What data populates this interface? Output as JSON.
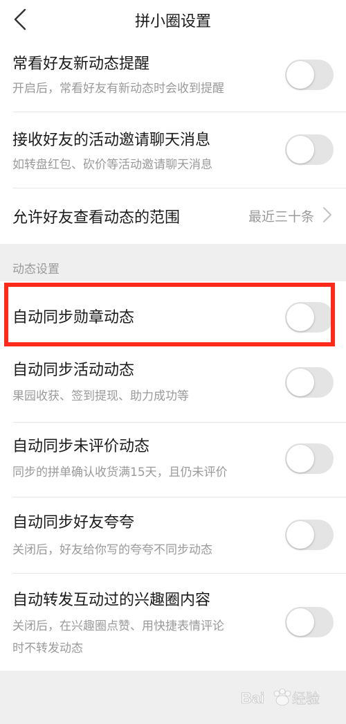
{
  "header": {
    "title": "拼小圈设置"
  },
  "settings_top": [
    {
      "title": "常看好友新动态提醒",
      "subtitle": "开启后，常看好友有新动态时会收到提醒",
      "enabled": false
    },
    {
      "title": "接收好友的活动邀请聊天消息",
      "subtitle": "如转盘红包、砍价等活动邀请聊天消息",
      "enabled": false
    }
  ],
  "visibility_range": {
    "title": "允许好友查看动态的范围",
    "value": "最近三十条"
  },
  "section": {
    "label": "动态设置"
  },
  "settings_dynamic": [
    {
      "title": "自动同步勋章动态",
      "enabled": false
    },
    {
      "title": "自动同步活动动态",
      "subtitle": "果园收获、签到提现、助力成功等",
      "enabled": false
    },
    {
      "title": "自动同步未评价动态",
      "subtitle": "同步的拼单确认收货满15天，且仍未评价",
      "enabled": false
    },
    {
      "title": "自动同步好友夸夸",
      "subtitle": "关闭后，好友给你写的夸夸不同步动态",
      "enabled": false
    },
    {
      "title": "自动转发互动过的兴趣圈内容",
      "subtitle_lines": [
        "关闭后，在兴趣圈点赞、用快捷表情评论",
        "时不转发动态"
      ],
      "enabled": false
    }
  ],
  "colors": {
    "highlight": "#ff2a1a",
    "toggle_off": "#e4e4e4",
    "background": "#efefef"
  },
  "watermark": {
    "text": "Bai 经验"
  }
}
